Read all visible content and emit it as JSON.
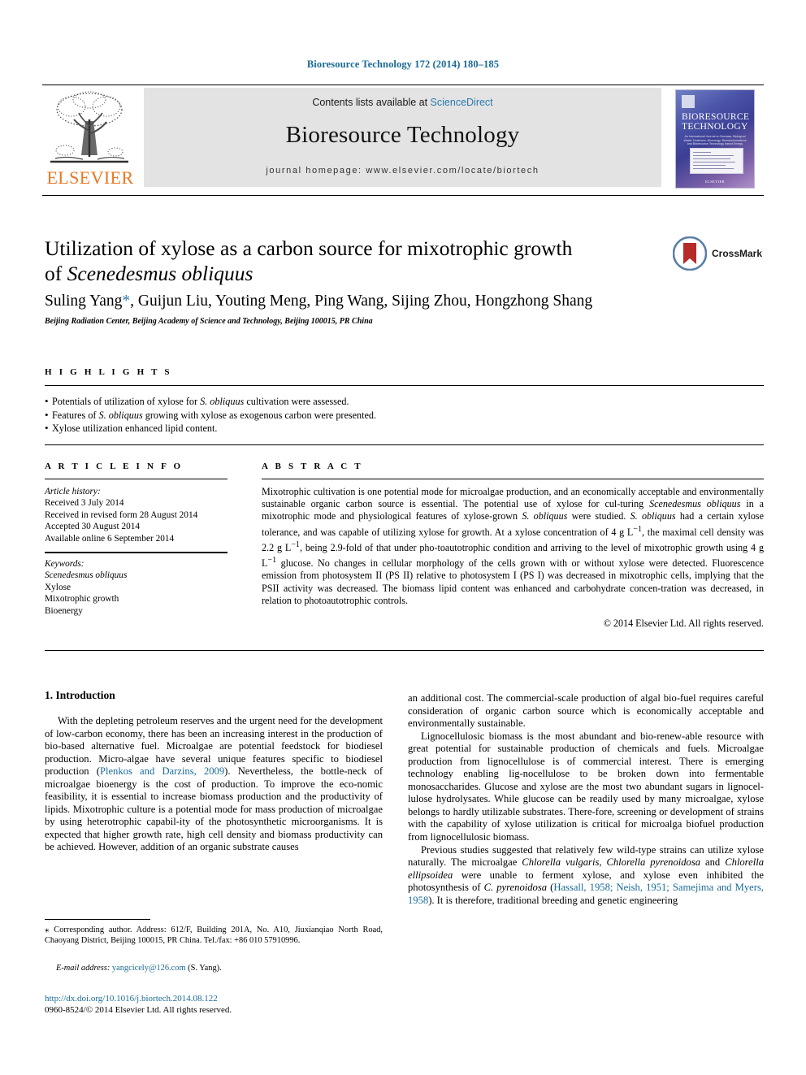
{
  "running_head": "Bioresource Technology 172 (2014) 180–185",
  "banner": {
    "contents_prefix": "Contents lists available at ",
    "sciencedirect": "ScienceDirect",
    "journal_name": "Bioresource Technology",
    "homepage": "journal homepage: www.elsevier.com/locate/biortech",
    "publisher_wordmark": "ELSEVIER",
    "cover": {
      "title_line1": "BIORESOURCE",
      "title_line2": "TECHNOLOGY",
      "subtitle": "An International Journal on Biomass, Biological Waste Treatment, Bioenergy, Biotransformations and Bioresource Technology based Energy",
      "footer": "ELSEVIER"
    }
  },
  "article": {
    "title_line1": "Utilization of xylose as a carbon source for mixotrophic growth",
    "title_line2_prefix": "of ",
    "title_line2_italic": "Scenedesmus obliquus",
    "authors": "Suling Yang",
    "authors_star": "*",
    "authors_rest": ", Guijun Liu, Youting Meng, Ping Wang, Sijing Zhou, Hongzhong Shang",
    "affiliation": "Beijing Radiation Center, Beijing Academy of Science and Technology, Beijing 100015, PR China",
    "crossmark_label": "CrossMark"
  },
  "highlights": {
    "heading": "H I G H L I G H T S",
    "items": [
      {
        "pre": "Potentials of utilization of xylose for ",
        "ital": "S. obliquus",
        "post": " cultivation were assessed."
      },
      {
        "pre": "Features of ",
        "ital": "S. obliquus",
        "post": " growing with xylose as exogenous carbon were presented."
      },
      {
        "pre": "Xylose utilization enhanced lipid content.",
        "ital": "",
        "post": ""
      }
    ]
  },
  "article_info": {
    "heading": "A R T I C L E   I N F O",
    "history_label": "Article history:",
    "history": [
      "Received 3 July 2014",
      "Received in revised form 28 August 2014",
      "Accepted 30 August 2014",
      "Available online 6 September 2014"
    ],
    "keywords_label": "Keywords:",
    "keywords": [
      "Scenedesmus obliquus",
      "Xylose",
      "Mixotrophic growth",
      "Bioenergy"
    ]
  },
  "abstract": {
    "heading": "A B S T R A C T",
    "p1": "Mixotrophic cultivation is one potential mode for microalgae production, and an economically acceptable and environmentally sustainable organic carbon source is essential. The potential use of xylose for cul-turing ",
    "sp1": "Scenedesmus obliquus",
    "p2": " in a mixotrophic mode and physiological features of xylose-grown ",
    "sp2": "S. obliquus",
    "p3": " were studied. ",
    "sp3": "S. obliquus",
    "p4": " had a certain xylose tolerance, and was capable of utilizing xylose for growth. At a xylose concentration of 4 g L",
    "sup1": "−1",
    "p5": ", the maximal cell density was 2.2 g L",
    "sup2": "−1",
    "p6": ", being 2.9-fold of that under pho-toautotrophic condition and arriving to the level of mixotrophic growth using 4 g L",
    "sup3": "−1",
    "p7": " glucose. No changes in cellular morphology of the cells grown with or without xylose were detected. Fluorescence emission from photosystem II (PS II) relative to photosystem I (PS I) was decreased in mixotrophic cells, implying that the PSII activity was decreased. The biomass lipid content was enhanced and carbohydrate concen-tration was decreased, in relation to photoautotrophic controls.",
    "copyright": "© 2014 Elsevier Ltd. All rights reserved."
  },
  "introduction": {
    "heading": "1. Introduction",
    "left": {
      "para1_a": "With the depleting petroleum reserves and the urgent need for the development of low-carbon economy, there has been an increasing interest in the production of bio-based alternative fuel. Microalgae are potential feedstock for biodiesel production. Micro-algae have several unique features specific to biodiesel production (",
      "cite1": "Plenkos and Darzins, 2009",
      "para1_b": "). Nevertheless, the bottle-neck of microalgae bioenergy is the cost of production. To improve the eco-nomic feasibility, it is essential to increase biomass production and the productivity of lipids. Mixotrophic culture is a potential mode for mass production of microalgae by using heterotrophic capabil-ity of the photosynthetic microorganisms. It is expected that higher growth rate, high cell density and biomass productivity can be achieved. However, addition of an organic substrate causes"
    },
    "right": {
      "para1": "an additional cost. The commercial-scale production of algal bio-fuel requires careful consideration of organic carbon source which is economically acceptable and environmentally sustainable.",
      "para2": "Lignocellulosic biomass is the most abundant and bio-renew-able resource with great potential for sustainable production of chemicals and fuels. Microalgae production from lignocellulose is of commercial interest. There is emerging technology enabling lig-nocellulose to be broken down into fermentable monosaccharides. Glucose and xylose are the most two abundant sugars in lignocel-lulose hydrolysates. While glucose can be readily used by many microalgae, xylose belongs to hardly utilizable substrates. There-fore, screening or development of strains with the capability of xylose utilization is critical for microalga biofuel production from lignocellulosic biomass.",
      "para3_a": "Previous studies suggested that relatively few wild-type strains can utilize xylose naturally. The microalgae ",
      "sp1": "Chlorella vulgaris, Chlorella pyrenoidosa",
      "para3_b": " and ",
      "sp2": "Chlorella ellipsoidea",
      "para3_c": " were unable to ferment xylose, and xylose even inhibited the photosynthesis of ",
      "sp3": "C. pyrenoidosa",
      "para3_d": " (",
      "cite2": "Hassall, 1958; Neish, 1951; Samejima and Myers, 1958",
      "para3_e": "). It is therefore, traditional breeding and genetic engineering"
    }
  },
  "footnotes": {
    "corresponding_star": "⁎",
    "corresponding": " Corresponding author. Address: 612/F, Building 201A, No. A10, Jiuxianqiao North Road, Chaoyang District, Beijing 100015, PR China. Tel./fax: +86 010 57910996.",
    "email_label": "E-mail address:",
    "email": "yangcicely@126.com",
    "email_suffix": " (S. Yang).",
    "doi": "http://dx.doi.org/10.1016/j.biortech.2014.08.122",
    "issn_line": "0960-8524/© 2014 Elsevier Ltd. All rights reserved."
  },
  "colors": {
    "link": "#1b6a96",
    "sciencedirect": "#2a7ab0",
    "elsevier_orange": "#E87722",
    "crossmark_red": "#b52b27"
  }
}
